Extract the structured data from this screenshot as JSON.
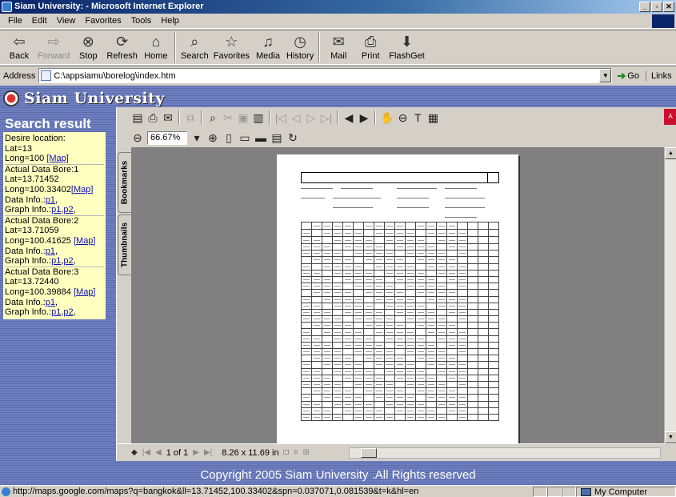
{
  "window": {
    "title": "Siam University: - Microsoft Internet Explorer",
    "controls": [
      "_",
      "▫",
      "✕"
    ]
  },
  "menu": [
    "File",
    "Edit",
    "View",
    "Favorites",
    "Tools",
    "Help"
  ],
  "toolbar": {
    "back": "Back",
    "forward": "Forward",
    "stop": "Stop",
    "refresh": "Refresh",
    "home": "Home",
    "search": "Search",
    "favorites": "Favorites",
    "media": "Media",
    "history": "History",
    "mail": "Mail",
    "print": "Print",
    "flashget": "FlashGet"
  },
  "address": {
    "label": "Address",
    "value": "C:\\appsiamu\\borelog\\index.htm",
    "go": "Go",
    "links": "Links"
  },
  "brand": {
    "name": "Siam University"
  },
  "search": {
    "title": "Search result",
    "desire": {
      "heading": "Desire location:",
      "lat": "Lat=13",
      "long": "Long=100",
      "map": "[Map]"
    },
    "bores": [
      {
        "heading": "Actual Data Bore:1",
        "lat": "Lat=13.71452",
        "long": "Long=100.33402",
        "map": "[Map]",
        "data_label": "Data Info.:",
        "data_links": [
          "p1"
        ],
        "graph_label": "Graph Info.:",
        "graph_links": [
          "p1",
          "p2"
        ]
      },
      {
        "heading": "Actual Data Bore:2",
        "lat": "Lat=13.71059",
        "long": "Long=100.41625",
        "map": "[Map]",
        "data_label": "Data Info.:",
        "data_links": [
          "p1"
        ],
        "graph_label": "Graph Info.:",
        "graph_links": [
          "p1",
          "p2"
        ]
      },
      {
        "heading": "Actual Data Bore:3",
        "lat": "Lat=13.72440",
        "long": "Long=100.39884",
        "map": "[Map]",
        "data_label": "Data Info.:",
        "data_links": [
          "p1"
        ],
        "graph_label": "Graph Info.:",
        "graph_links": [
          "p1",
          "p2"
        ]
      }
    ]
  },
  "viewer": {
    "zoom": "66.67%",
    "tabs": {
      "bookmarks": "Bookmarks",
      "thumbnails": "Thumbnails"
    },
    "page_indicator": "1 of 1",
    "page_size": "8.26 x 11.69 in"
  },
  "footer": {
    "copyright": "Copyright 2005 Siam University .All Rights reserved"
  },
  "status": {
    "url": "http://maps.google.com/maps?q=bangkok&ll=13.71452,100.33402&spn=0.037071,0.081539&t=k&hl=en",
    "zone": "My Computer"
  }
}
